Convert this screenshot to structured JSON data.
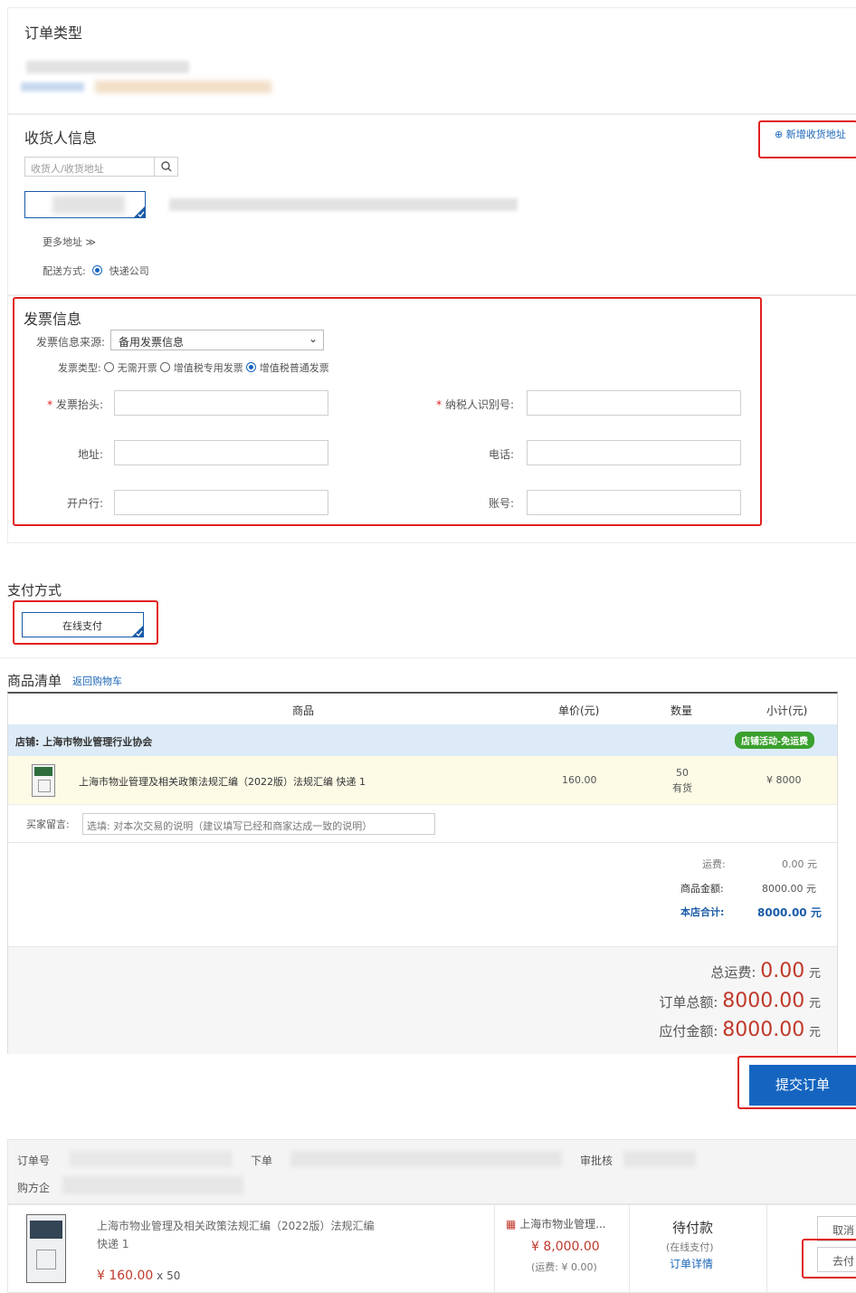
{
  "order_type": {
    "title": "订单类型"
  },
  "consignee": {
    "title": "收货人信息",
    "add_address": "新增收货地址",
    "search_placeholder": "收货人/收货地址",
    "more_address": "更多地址",
    "delivery_label": "配送方式:",
    "delivery_option": "快递公司"
  },
  "invoice": {
    "title": "发票信息",
    "source_label": "发票信息来源:",
    "source_value": "备用发票信息",
    "type_label": "发票类型:",
    "type_options": [
      "无需开票",
      "增值税专用发票",
      "增值税普通发票"
    ],
    "header_label": "发票抬头:",
    "taxid_label": "纳税人识别号:",
    "address_label": "地址:",
    "phone_label": "电话:",
    "bank_label": "开户行:",
    "account_label": "账号:"
  },
  "payment": {
    "title": "支付方式",
    "option": "在线支付"
  },
  "goods": {
    "title": "商品清单",
    "back_link": "返回购物车",
    "headers": [
      "商品",
      "单价(元)",
      "数量",
      "小计(元)"
    ],
    "store_label": "店铺: 上海市物业管理行业协会",
    "promo_badge": "店铺活动-免运费",
    "item_name": "上海市物业管理及相关政策法规汇编（2022版）法规汇编 快递 1",
    "item_price": "160.00",
    "item_qty": "50",
    "item_stock": "有货",
    "item_subtotal": "¥ 8000",
    "buyer_msg_label": "买家留言:",
    "buyer_msg_placeholder": "选填: 对本次交易的说明（建议填写已经和商家达成一致的说明）",
    "shipping_label": "运费:",
    "shipping_value": "0.00 元",
    "goods_amount_label": "商品金额:",
    "goods_amount_value": "8000.00 元",
    "store_total_label": "本店合计:",
    "store_total_value": "8000.00 元"
  },
  "totals": {
    "shipping_label": "总运费:",
    "shipping_value": "0.00",
    "order_total_label": "订单总额:",
    "order_total_value": "8000.00",
    "payable_label": "应付金额:",
    "payable_value": "8000.00",
    "unit": "元",
    "submit": "提交订单"
  },
  "order_list": {
    "order_no_label": "订单号",
    "order_time_label": "下单",
    "approver_label": "审批核",
    "buyer_label": "购方企",
    "item_name": "上海市物业管理及相关政策法规汇编（2022版）法规汇编",
    "item_ship": "快递 1",
    "item_price": "¥ 160.00",
    "item_qty": "x 50",
    "store_name": "上海市物业管理...",
    "amount": "¥ 8,000.00",
    "shipping": "(运费: ¥ 0.00)",
    "status": "待付款",
    "pay_mode": "(在线支付)",
    "detail_link": "订单详情",
    "cancel_btn": "取消",
    "pay_btn": "去付"
  }
}
